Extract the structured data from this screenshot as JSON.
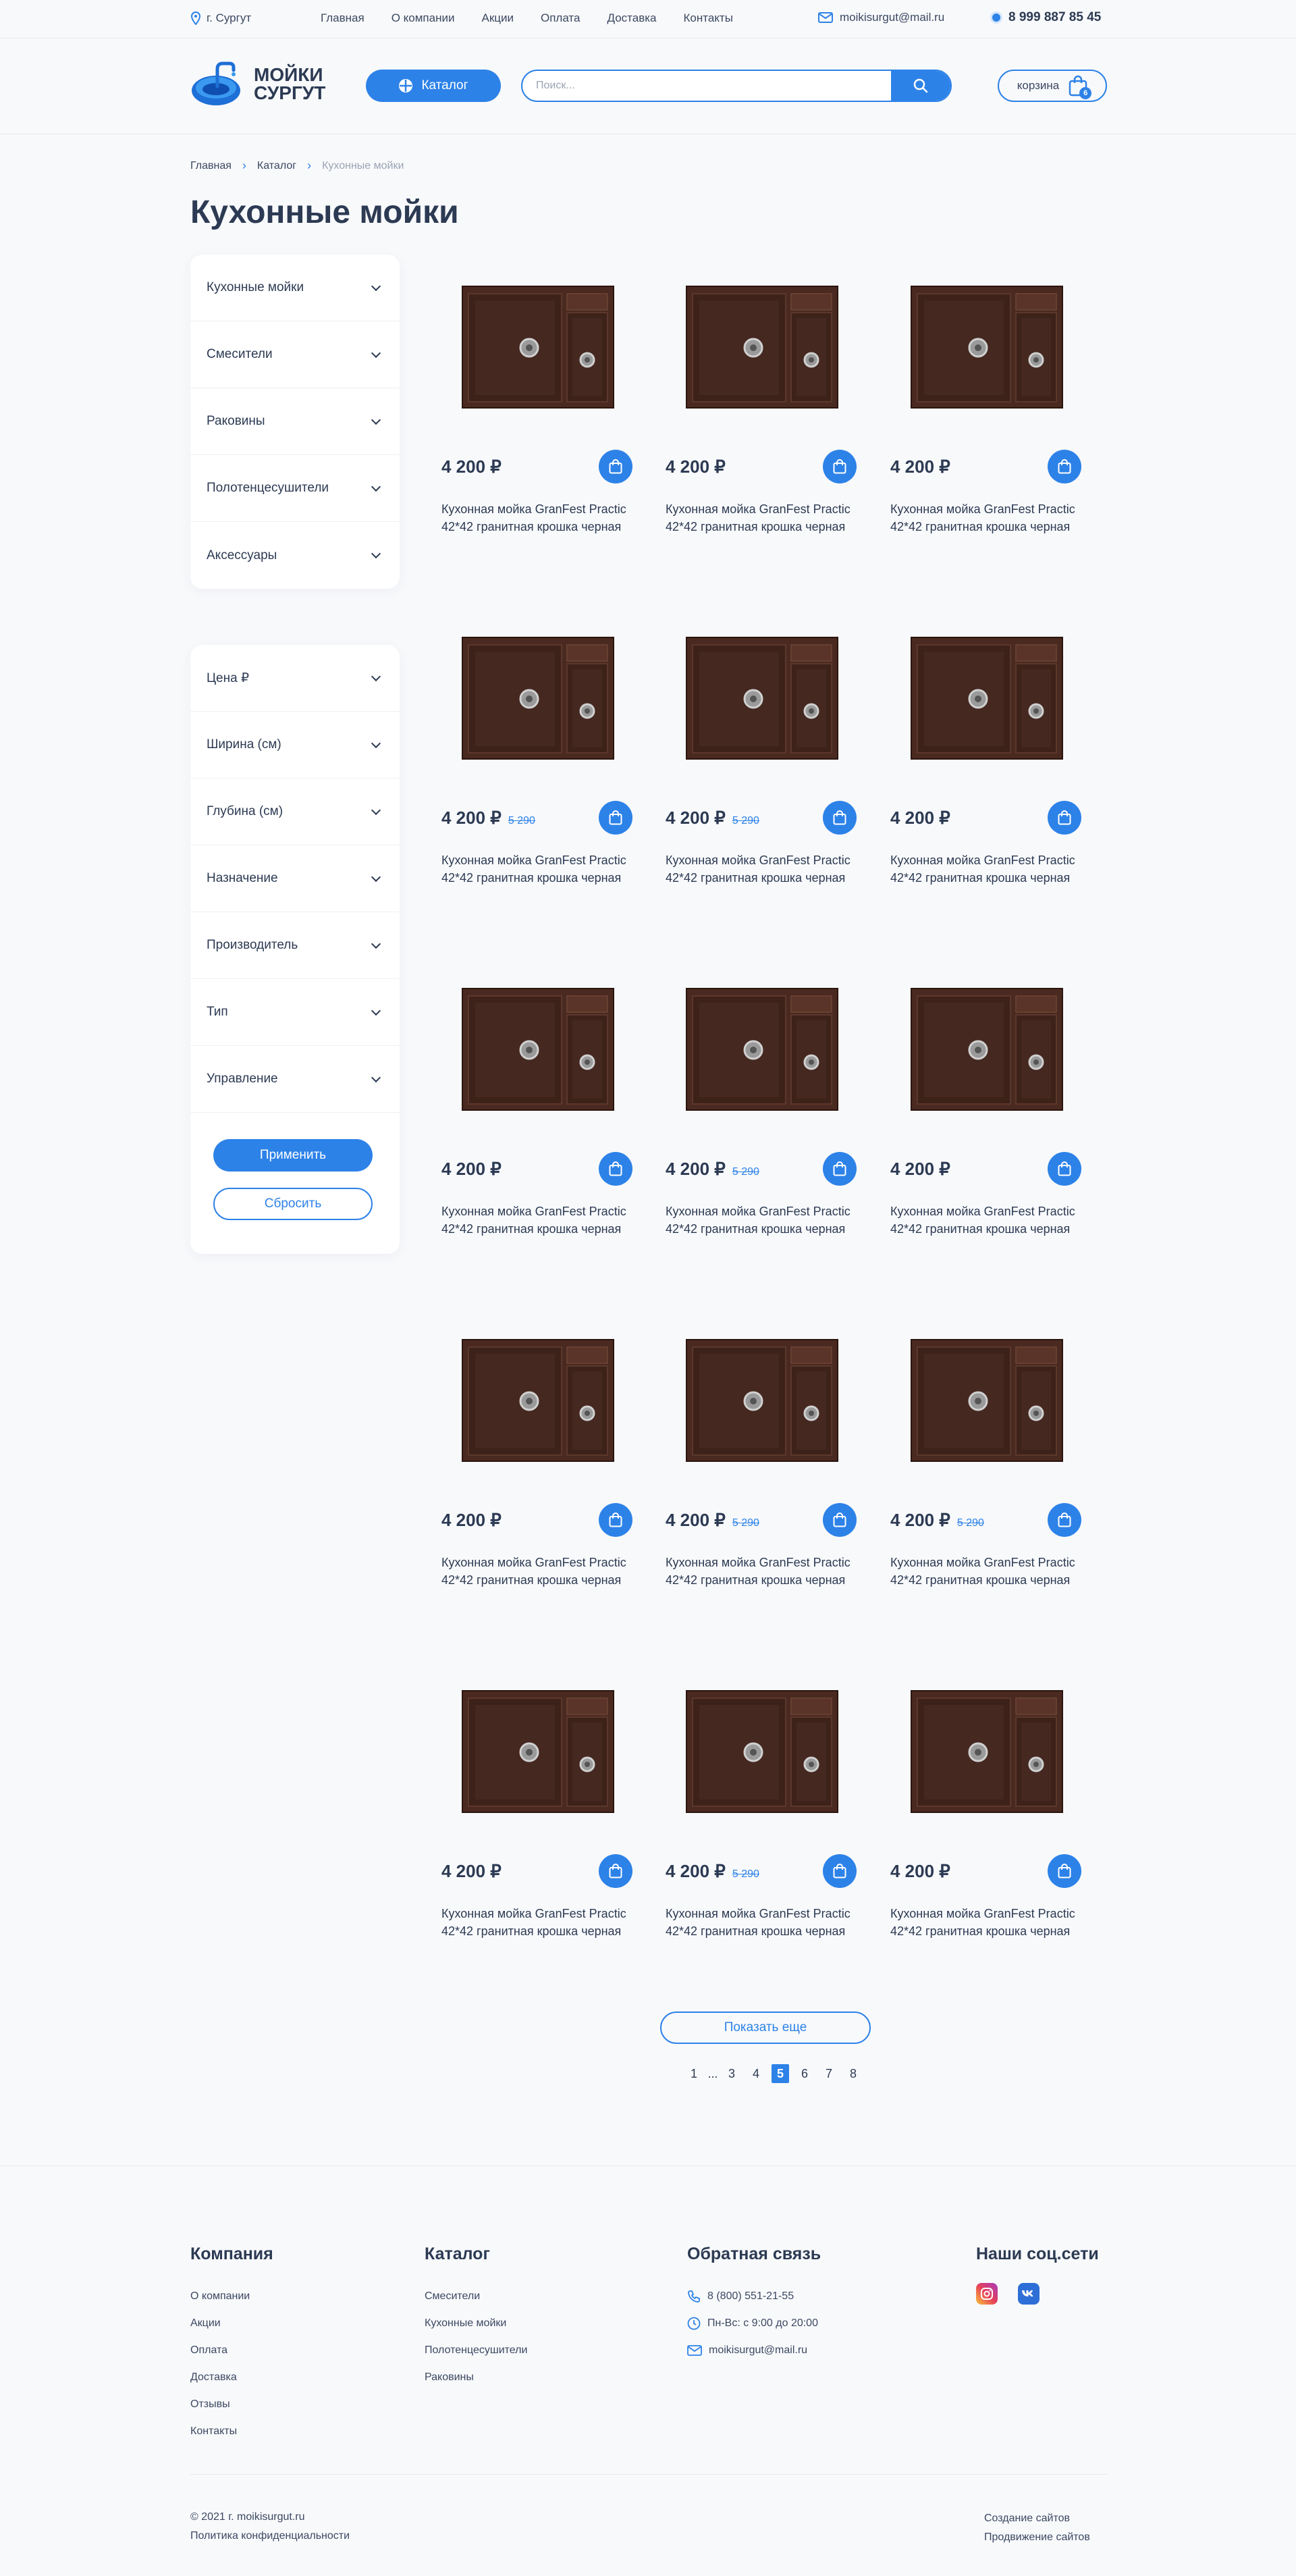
{
  "topbar": {
    "city": "г. Сургут",
    "nav": [
      "Главная",
      "О компании",
      "Акции",
      "Оплата",
      "Доставка",
      "Контакты"
    ],
    "email": "moikisurgut@mail.ru",
    "phone": "8 999 887 85 45"
  },
  "header": {
    "logo_line1": "МОЙКИ",
    "logo_line2": "СУРГУТ",
    "catalog_label": "Каталог",
    "search_placeholder": "Поиск...",
    "cart_label": "корзина",
    "cart_count": "6"
  },
  "breadcrumb": [
    "Главная",
    "Каталог",
    "Кухонные мойки"
  ],
  "page_title": "Кухонные мойки",
  "categories": [
    "Кухонные мойки",
    "Смесители",
    "Раковины",
    "Полотенцесушители",
    "Аксессуары"
  ],
  "filters": {
    "items": [
      "Цена ₽",
      "Ширина (см)",
      "Глубина (см)",
      "Назначение",
      "Производитель",
      "Тип",
      "Управление"
    ],
    "apply_label": "Применить",
    "reset_label": "Сбросить"
  },
  "products": [
    {
      "price": "4 200 ₽",
      "old_price": "",
      "name": "Кухонная мойка GranFest Practic 42*42 гранитная крошка черная"
    },
    {
      "price": "4 200 ₽",
      "old_price": "",
      "name": "Кухонная мойка GranFest Practic 42*42 гранитная крошка черная"
    },
    {
      "price": "4 200 ₽",
      "old_price": "",
      "name": "Кухонная мойка GranFest Practic 42*42 гранитная крошка черная"
    },
    {
      "price": "4 200 ₽",
      "old_price": "5 290",
      "name": "Кухонная мойка GranFest Practic 42*42 гранитная крошка черная"
    },
    {
      "price": "4 200 ₽",
      "old_price": "5 290",
      "name": "Кухонная мойка GranFest Practic 42*42 гранитная крошка черная"
    },
    {
      "price": "4 200 ₽",
      "old_price": "",
      "name": "Кухонная мойка GranFest Practic 42*42 гранитная крошка черная"
    },
    {
      "price": "4 200 ₽",
      "old_price": "",
      "name": "Кухонная мойка GranFest Practic 42*42 гранитная крошка черная"
    },
    {
      "price": "4 200 ₽",
      "old_price": "5 290",
      "name": "Кухонная мойка GranFest Practic 42*42 гранитная крошка черная"
    },
    {
      "price": "4 200 ₽",
      "old_price": "",
      "name": "Кухонная мойка GranFest Practic 42*42 гранитная крошка черная"
    },
    {
      "price": "4 200 ₽",
      "old_price": "",
      "name": "Кухонная мойка GranFest Practic 42*42 гранитная крошка черная"
    },
    {
      "price": "4 200 ₽",
      "old_price": "5 290",
      "name": "Кухонная мойка GranFest Practic 42*42 гранитная крошка черная"
    },
    {
      "price": "4 200 ₽",
      "old_price": "5 290",
      "name": "Кухонная мойка GranFest Practic 42*42 гранитная крошка черная"
    },
    {
      "price": "4 200 ₽",
      "old_price": "",
      "name": "Кухонная мойка GranFest Practic 42*42 гранитная крошка черная"
    },
    {
      "price": "4 200 ₽",
      "old_price": "5 290",
      "name": "Кухонная мойка GranFest Practic 42*42 гранитная крошка черная"
    },
    {
      "price": "4 200 ₽",
      "old_price": "",
      "name": "Кухонная мойка GranFest Practic 42*42 гранитная крошка черная"
    }
  ],
  "show_more_label": "Показать еще",
  "pagination": {
    "pages": [
      "1",
      "...",
      "3",
      "4",
      "5",
      "6",
      "7",
      "8"
    ],
    "current": "5"
  },
  "footer": {
    "company": {
      "title": "Компания",
      "links": [
        "О компании",
        "Акции",
        "Оплата",
        "Доставка",
        "Отзывы",
        "Контакты"
      ]
    },
    "catalog": {
      "title": "Каталог",
      "links": [
        "Смесители",
        "Кухонные мойки",
        "Полотенцесушители",
        "Раковины"
      ]
    },
    "feedback": {
      "title": "Обратная связь",
      "phone": "8 (800) 551-21-55",
      "hours": "Пн-Вс: с 9:00 до 20:00",
      "email": "moikisurgut@mail.ru"
    },
    "social": {
      "title": "Наши соц.сети",
      "icons": [
        "instagram-icon",
        "vk-icon"
      ]
    },
    "copyright": "© 2021 г. moikisurgut.ru",
    "privacy": "Политика конфиденциальности",
    "dev1": "Создание сайтов",
    "dev2": "Продвижение сайтов"
  },
  "colors": {
    "accent": "#2d82e8",
    "text": "#2c3a53",
    "background": "#f8f9fb",
    "sink": "#4a2a20"
  }
}
